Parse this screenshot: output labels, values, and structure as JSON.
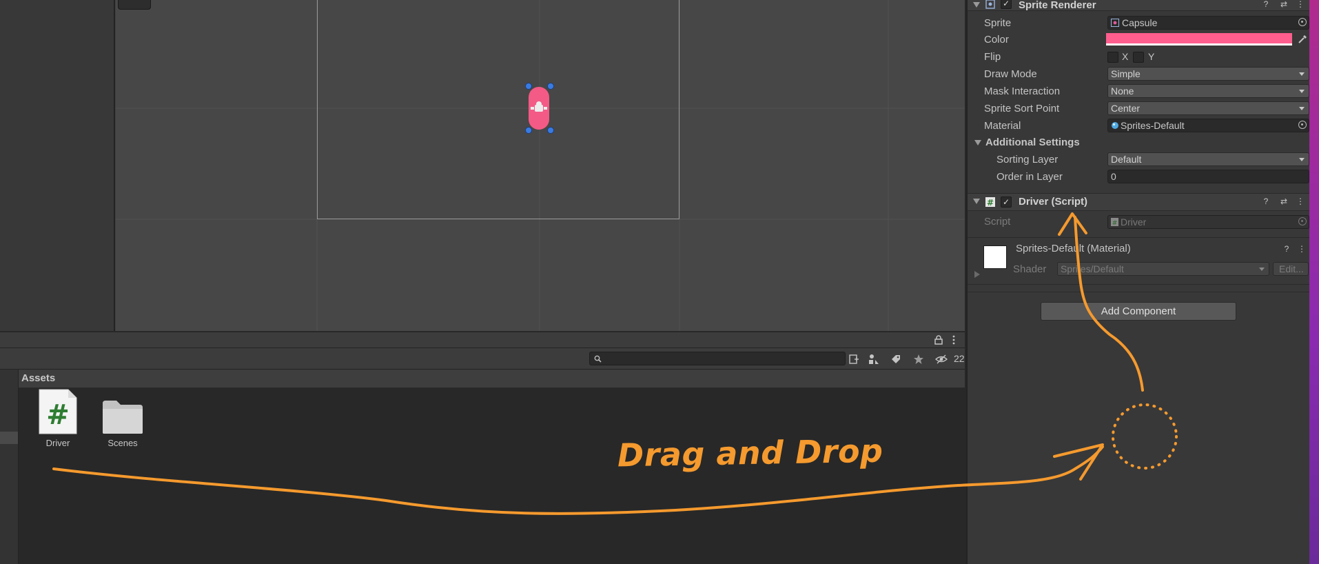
{
  "scene": {
    "colors": {
      "background": "#474747",
      "sprite": "#f35a86",
      "handles": "#3a7be2"
    }
  },
  "project": {
    "search": {
      "value": "",
      "placeholder": ""
    },
    "hidden_packages_count": "22",
    "breadcrumb": "Assets",
    "assets": [
      {
        "label": "Driver",
        "icon": "csharp-script-icon"
      },
      {
        "label": "Scenes",
        "icon": "folder-icon"
      }
    ]
  },
  "inspector": {
    "sprite_renderer": {
      "title": "Sprite Renderer",
      "enabled": true,
      "properties": {
        "sprite": {
          "label": "Sprite",
          "value": "Capsule"
        },
        "color": {
          "label": "Color",
          "value": "#fd5e8e"
        },
        "flip": {
          "label": "Flip",
          "x": "X",
          "y": "Y"
        },
        "draw_mode": {
          "label": "Draw Mode",
          "value": "Simple"
        },
        "mask_interaction": {
          "label": "Mask Interaction",
          "value": "None"
        },
        "sprite_sort_point": {
          "label": "Sprite Sort Point",
          "value": "Center"
        },
        "material": {
          "label": "Material",
          "value": "Sprites-Default"
        }
      },
      "additional_settings": {
        "title": "Additional Settings",
        "sorting_layer": {
          "label": "Sorting Layer",
          "value": "Default"
        },
        "order_in_layer": {
          "label": "Order in Layer",
          "value": "0"
        }
      }
    },
    "driver_script": {
      "title": "Driver (Script)",
      "enabled": true,
      "script": {
        "label": "Script",
        "value": "Driver"
      }
    },
    "material": {
      "title": "Sprites-Default (Material)",
      "shader": {
        "label": "Shader",
        "value": "Sprites/Default",
        "edit_label": "Edit..."
      }
    },
    "add_component_label": "Add Component"
  },
  "annotation": {
    "text": "Drag and Drop",
    "color": "#f59a2e"
  }
}
